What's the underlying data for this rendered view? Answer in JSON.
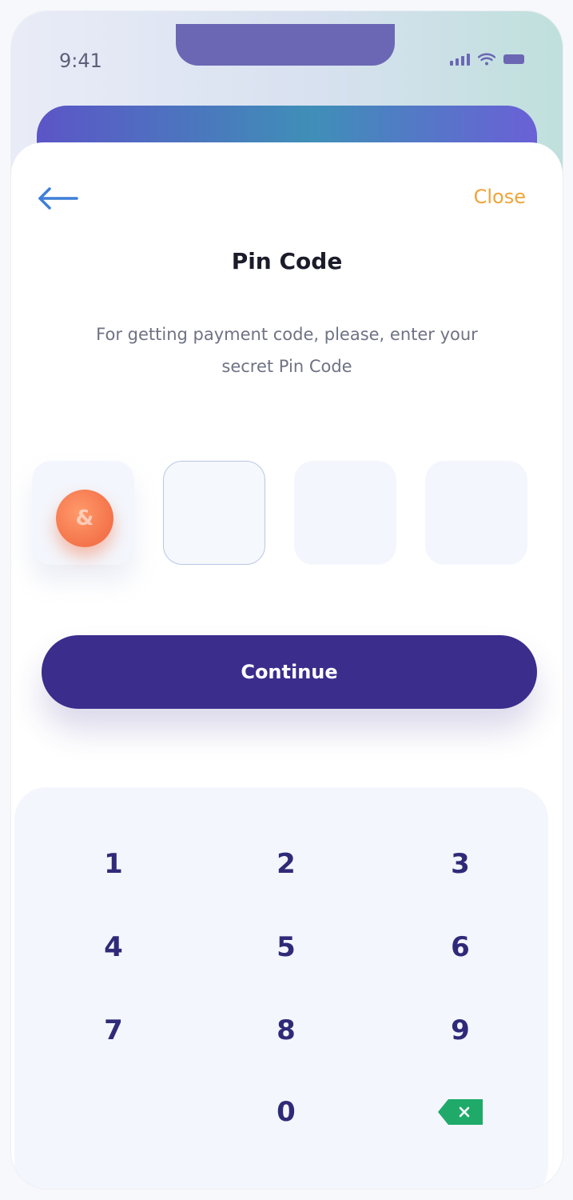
{
  "status_bar": {
    "time": "9:41"
  },
  "header": {
    "back_icon": "arrow-left-icon",
    "close_label": "Close"
  },
  "title": "Pin Code",
  "subtitle": "For getting payment code, please, enter your secret Pin Code",
  "pin": {
    "slots": 4,
    "filled_count": 1,
    "active_index": 1,
    "filled_glyph": "&"
  },
  "continue_label": "Continue",
  "keypad": {
    "keys": [
      "1",
      "2",
      "3",
      "4",
      "5",
      "6",
      "7",
      "8",
      "9",
      "0"
    ],
    "delete_icon": "backspace-icon"
  },
  "colors": {
    "primary": "#3a2d8c",
    "accent": "#f0a43a",
    "pin_dot": "#f4734a",
    "delete": "#1faa6a",
    "back_arrow": "#3d7fd9"
  }
}
